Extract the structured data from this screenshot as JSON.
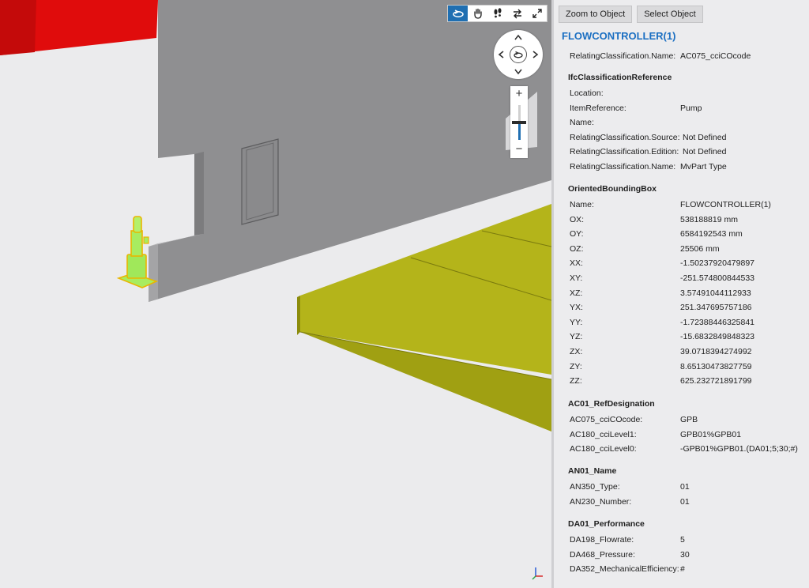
{
  "toolbar": {
    "tools": [
      {
        "name": "orbit",
        "active": true
      },
      {
        "name": "pan",
        "active": false
      },
      {
        "name": "walk",
        "active": false
      },
      {
        "name": "swap",
        "active": false
      },
      {
        "name": "fullscreen",
        "active": false
      }
    ]
  },
  "navigation": {
    "zoom_plus": "+",
    "zoom_minus": "−",
    "zoom_level": 0.5
  },
  "panel": {
    "zoom_to_object": "Zoom to Object",
    "select_object": "Select Object",
    "title": "FLOWCONTROLLER(1)",
    "top_row": {
      "key": "RelatingClassification.Name:",
      "value": "AC075_cciCOcode"
    },
    "sections": [
      {
        "heading": "IfcClassificationReference",
        "rows": [
          {
            "key": "Location:",
            "value": ""
          },
          {
            "key": "ItemReference:",
            "value": "Pump"
          },
          {
            "key": "Name:",
            "value": ""
          },
          {
            "key": "RelatingClassification.Source:",
            "value": "Not Defined"
          },
          {
            "key": "RelatingClassification.Edition:",
            "value": "Not Defined"
          },
          {
            "key": "RelatingClassification.Name:",
            "value": "MvPart Type"
          }
        ]
      },
      {
        "heading": "OrientedBoundingBox",
        "rows": [
          {
            "key": "Name:",
            "value": "FLOWCONTROLLER(1)"
          },
          {
            "key": "OX:",
            "value": "538188819 mm"
          },
          {
            "key": "OY:",
            "value": "6584192543 mm"
          },
          {
            "key": "OZ:",
            "value": "25506 mm"
          },
          {
            "key": "XX:",
            "value": "-1.50237920479897"
          },
          {
            "key": "XY:",
            "value": "-251.574800844533"
          },
          {
            "key": "XZ:",
            "value": "3.57491044112933"
          },
          {
            "key": "YX:",
            "value": "251.347695757186"
          },
          {
            "key": "YY:",
            "value": "-1.72388446325841"
          },
          {
            "key": "YZ:",
            "value": "-15.6832849848323"
          },
          {
            "key": "ZX:",
            "value": "39.0718394274992"
          },
          {
            "key": "ZY:",
            "value": "8.65130473827759"
          },
          {
            "key": "ZZ:",
            "value": "625.232721891799"
          }
        ]
      },
      {
        "heading": "AC01_RefDesignation",
        "rows": [
          {
            "key": "AC075_cciCOcode:",
            "value": "GPB"
          },
          {
            "key": "AC180_cciLevel1:",
            "value": "GPB01%GPB01"
          },
          {
            "key": "AC180_cciLevel0:",
            "value": "-GPB01%GPB01.(DA01;5;30;#)"
          }
        ]
      },
      {
        "heading": "AN01_Name",
        "rows": [
          {
            "key": "AN350_Type:",
            "value": "01"
          },
          {
            "key": "AN230_Number:",
            "value": "01"
          }
        ]
      },
      {
        "heading": "DA01_Performance",
        "rows": [
          {
            "key": "DA198_Flowrate:",
            "value": "5"
          },
          {
            "key": "DA468_Pressure:",
            "value": "30"
          },
          {
            "key": "DA352_MechanicalEfficiency:",
            "value": "#"
          }
        ]
      }
    ]
  },
  "colors": {
    "accent": "#1f6fb2",
    "title": "#1b6fc2",
    "wall": "#8c8c8c",
    "slab": "#a6a614",
    "red_object": "#e00c0c",
    "selection": "#9fe860"
  }
}
